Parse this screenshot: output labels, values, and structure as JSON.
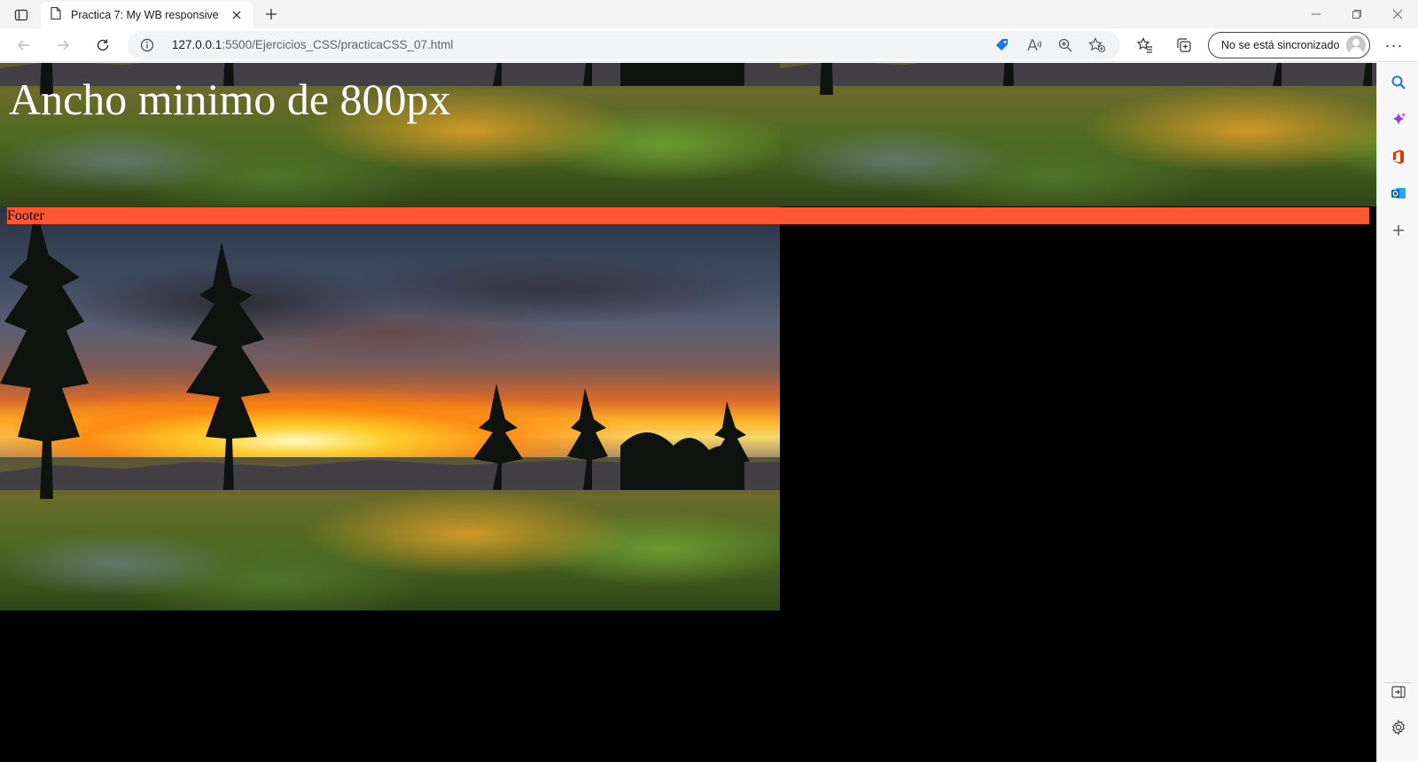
{
  "browser": {
    "tab": {
      "title": "Practica 7: My WB responsive"
    },
    "address": {
      "host": "127.0.0.1",
      "path": ":5500/Ejercicios_CSS/practicaCSS_07.html"
    },
    "sync_button_label": "No se está sincronizado"
  },
  "page": {
    "heading": "Ancho minimo de 800px",
    "footer_text": "Footer",
    "footer_color": "#ff5733",
    "background_tiles": 4
  },
  "icons": {
    "tab_actions": "tab-actions-icon",
    "page": "page-icon",
    "close": "close-icon",
    "new_tab": "plus-icon",
    "minimize": "minimize-icon",
    "restore": "restore-icon",
    "window_close": "close-icon",
    "back": "back-arrow-icon",
    "forward": "forward-arrow-icon",
    "refresh": "refresh-icon",
    "info": "info-icon",
    "shopping": "tag-icon",
    "read_aloud": "read-aloud-icon",
    "zoom": "zoom-in-icon",
    "add_favorite": "star-plus-icon",
    "favorites": "favorites-icon",
    "collections": "collections-icon",
    "more": "more-icon",
    "sidebar": [
      "search-icon",
      "copilot-icon",
      "office-icon",
      "outlook-icon",
      "plus-icon",
      "hide-sidebar-icon",
      "settings-icon"
    ]
  }
}
